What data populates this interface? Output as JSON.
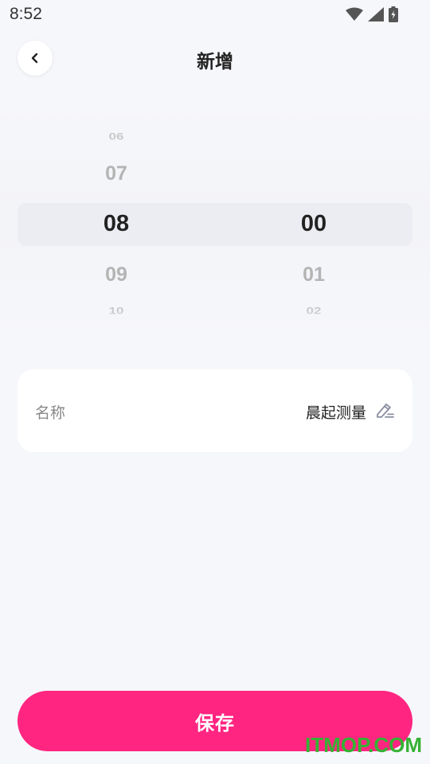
{
  "status_bar": {
    "time": "8:52",
    "icons": [
      "wifi-icon",
      "signal-icon",
      "battery-icon"
    ]
  },
  "header": {
    "title": "新增",
    "back_icon": "chevron-left-icon"
  },
  "time_picker": {
    "hours": {
      "above_far": "06",
      "above_near": "07",
      "selected": "08",
      "below_near": "09",
      "below_far": "10"
    },
    "minutes": {
      "above_far": "",
      "above_near": "",
      "selected": "00",
      "below_near": "01",
      "below_far": "02"
    }
  },
  "name_field": {
    "label": "名称",
    "value": "晨起测量",
    "edit_icon": "edit-pencil-icon"
  },
  "save_button": {
    "label": "保存"
  },
  "watermark": {
    "text": "ITMOP.COM"
  },
  "colors": {
    "accent": "#ff2580",
    "background": "#f6f7fb",
    "watermark": "#34b233"
  }
}
